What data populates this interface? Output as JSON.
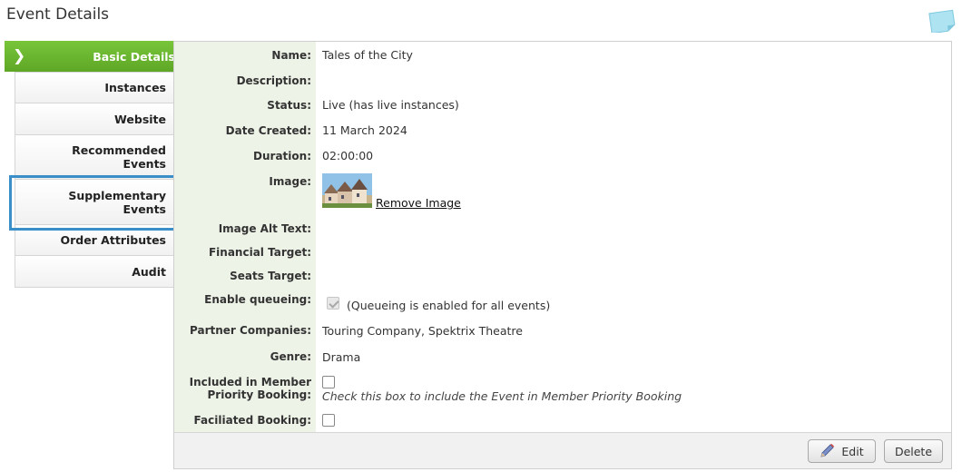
{
  "page": {
    "title": "Event Details"
  },
  "sidebar": {
    "active": "Basic Details",
    "items": [
      {
        "label": "Instances"
      },
      {
        "label": "Website"
      },
      {
        "label": "Recommended Events"
      },
      {
        "label": "Supplementary Events"
      },
      {
        "label": "Order Attributes"
      },
      {
        "label": "Audit"
      }
    ]
  },
  "details": {
    "name_label": "Name:",
    "name_value": "Tales of the City",
    "description_label": "Description:",
    "status_label": "Status:",
    "status_value": "Live (has live instances)",
    "date_label": "Date Created:",
    "date_value": "11 March 2024",
    "duration_label": "Duration:",
    "duration_value": "02:00:00",
    "image_label": "Image:",
    "remove_image": "Remove Image",
    "alt_label": "Image Alt Text:",
    "financial_label": "Financial Target:",
    "seats_label": "Seats Target:",
    "queueing_label": "Enable queueing:",
    "queueing_checked": true,
    "queueing_note": "(Queueing is enabled for all events)",
    "partners_label": "Partner Companies:",
    "partners_value": "Touring Company, Spektrix Theatre",
    "genre_label": "Genre:",
    "genre_value": "Drama",
    "member_label_1": "Included in Member",
    "member_label_2": "Priority Booking:",
    "member_checked": false,
    "member_hint": "Check this box to include the Event in Member Priority Booking",
    "facilitated_label": "Faciliated Booking:",
    "facilitated_checked": false
  },
  "footer": {
    "edit_label": "Edit",
    "delete_label": "Delete"
  },
  "colors": {
    "active_tab": "#6ab52f",
    "highlight": "#3b8fc9",
    "label_bg": "#eef3e8"
  }
}
